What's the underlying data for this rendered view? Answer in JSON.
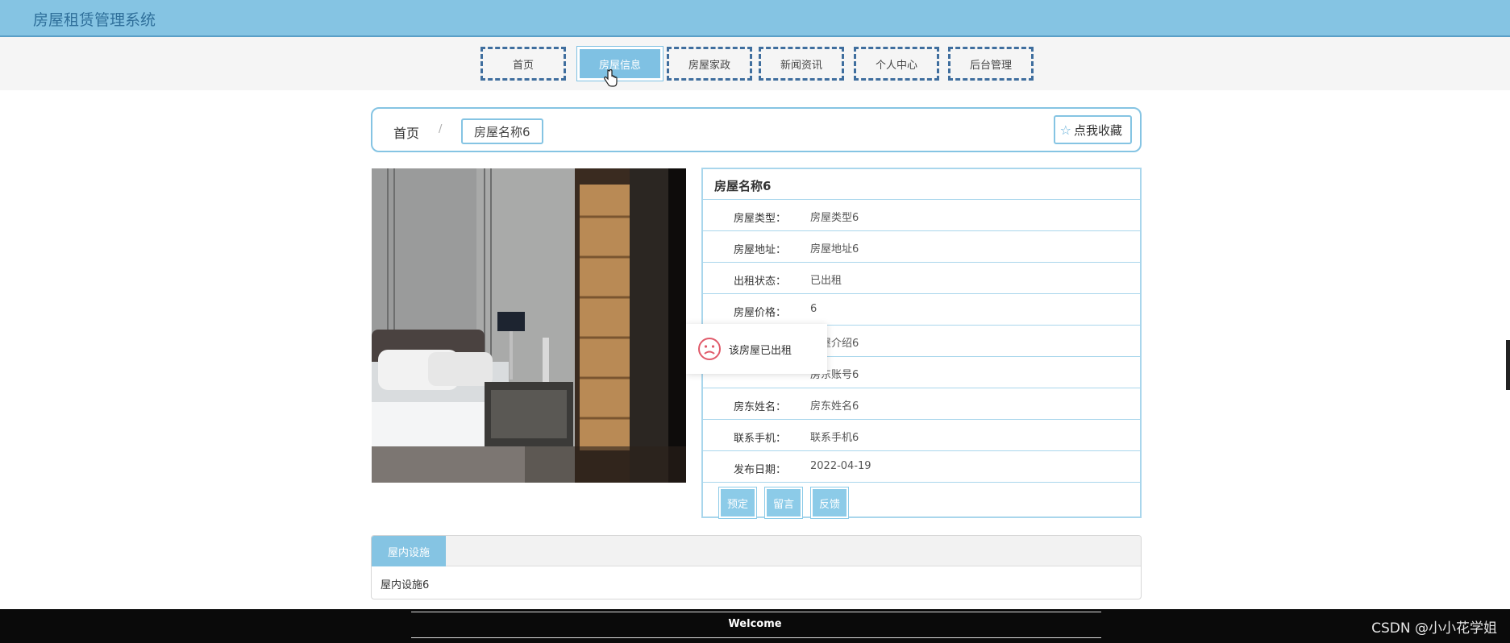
{
  "app": {
    "title": "房屋租赁管理系统"
  },
  "nav": {
    "items": [
      "首页",
      "房屋信息",
      "房屋家政",
      "新闻资讯",
      "个人中心",
      "后台管理"
    ],
    "active_index": 1
  },
  "breadcrumb": {
    "home": "首页",
    "sep": "/",
    "current": "房屋名称6"
  },
  "favorite": {
    "label": "点我收藏"
  },
  "detail": {
    "title": "房屋名称6",
    "rows": [
      {
        "label": "房屋类型：",
        "value": "房屋类型6"
      },
      {
        "label": "房屋地址：",
        "value": "房屋地址6"
      },
      {
        "label": "出租状态：",
        "value": "已出租"
      },
      {
        "label": "房屋价格：",
        "value": "6"
      },
      {
        "label": "",
        "value": "房屋介绍6"
      },
      {
        "label": "",
        "value": "房东账号6"
      },
      {
        "label": "房东姓名：",
        "value": "房东姓名6"
      },
      {
        "label": "联系手机：",
        "value": "联系手机6"
      },
      {
        "label": "发布日期：",
        "value": "2022-04-19"
      }
    ],
    "buttons": [
      "预定",
      "留言",
      "反馈"
    ]
  },
  "toast": {
    "message": "该房屋已出租"
  },
  "facilities": {
    "tab": "屋内设施",
    "content": "屋内设施6"
  },
  "footer": {
    "welcome": "Welcome",
    "watermark": "CSDN @小小花学姐"
  },
  "colors": {
    "header": "#85c4e3",
    "accent": "#8ccbe8",
    "nav_border": "#3f6e9e"
  }
}
